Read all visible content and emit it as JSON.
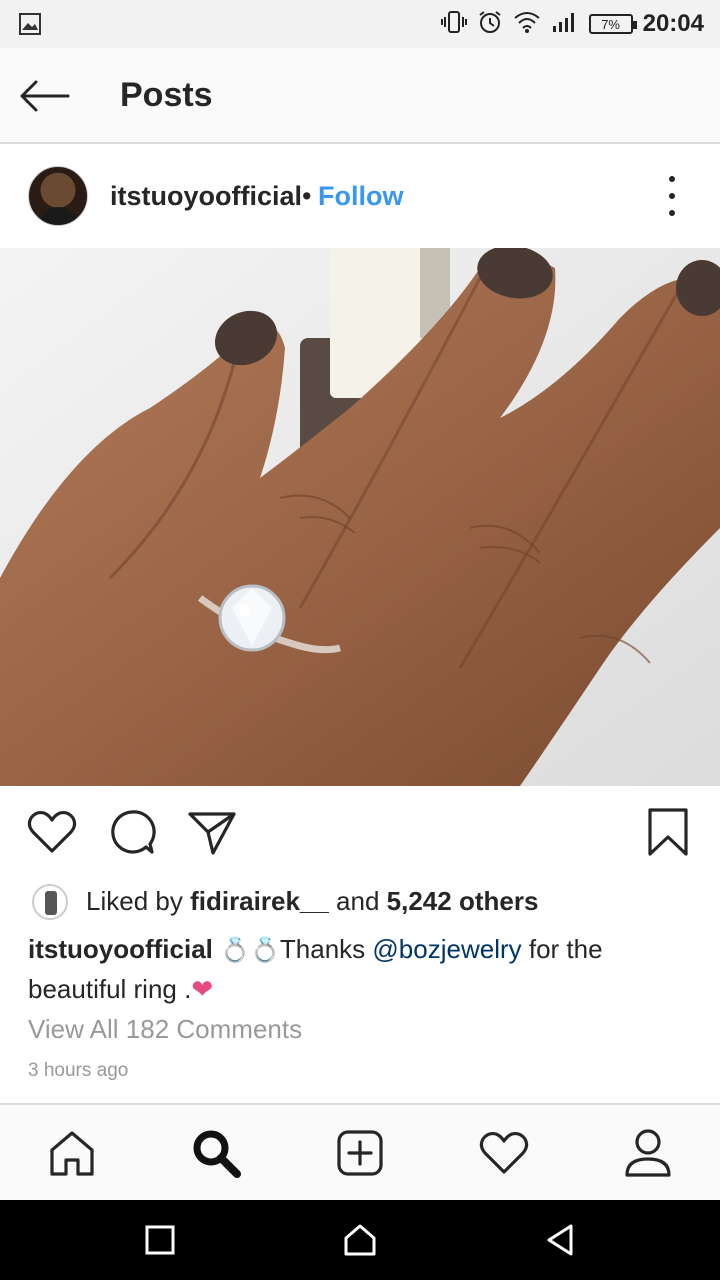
{
  "status_bar": {
    "time": "20:04",
    "battery": "7%",
    "icons": [
      "image-icon",
      "vibrate-icon",
      "alarm-icon",
      "wifi-icon",
      "signal-icon",
      "battery-icon"
    ]
  },
  "header": {
    "title": "Posts",
    "back_icon": "back-arrow-icon"
  },
  "post": {
    "username": "itstuoyoofficial",
    "separator": "•",
    "follow_label": "Follow",
    "more_icon": "more-vertical-icon",
    "likes": {
      "prefix": "Liked by ",
      "user": "fidirairek__",
      "middle": " and ",
      "count_text": "5,242 others"
    },
    "caption": {
      "username": "itstuoyoofficial",
      "text_before": "Thanks ",
      "mention": "@bozjewelry",
      "text_after": " for the beautiful ring ."
    },
    "view_all_comments": "View All 182 Comments",
    "time_ago": "3 hours ago"
  },
  "actions": [
    "like-icon",
    "comment-icon",
    "share-icon",
    "bookmark-icon"
  ],
  "bottom_nav": [
    "home-icon",
    "search-icon",
    "add-post-icon",
    "activity-icon",
    "profile-icon"
  ],
  "system_nav": [
    "recents-icon",
    "home-icon",
    "back-icon"
  ],
  "colors": {
    "follow": "#3897f0",
    "mention": "#003569",
    "muted_text": "#999999",
    "heart": "#e84a7f"
  }
}
